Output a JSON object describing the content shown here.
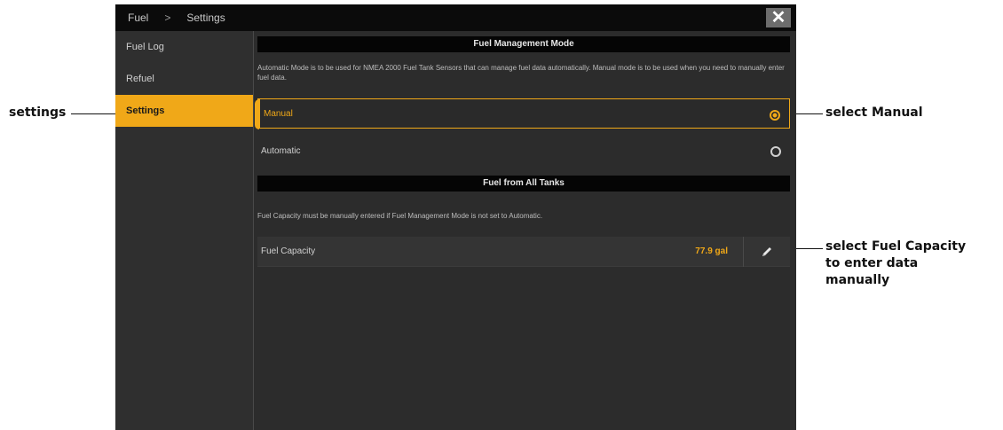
{
  "window": {
    "breadcrumb": [
      "Fuel",
      "Settings"
    ],
    "breadcrumb_sep": ">",
    "close_label": "✕"
  },
  "sidebar": {
    "items": [
      {
        "label": "Fuel Log",
        "active": false
      },
      {
        "label": "Refuel",
        "active": false
      },
      {
        "label": "Settings",
        "active": true
      }
    ]
  },
  "main": {
    "mode_header": "Fuel Management Mode",
    "mode_desc": "Automatic Mode is to be used for NMEA 2000 Fuel Tank Sensors that can manage fuel data automatically. Manual mode is to be used when you need to manually enter fuel data.",
    "options": [
      {
        "label": "Manual",
        "selected": true
      },
      {
        "label": "Automatic",
        "selected": false
      }
    ],
    "tanks_header": "Fuel from All Tanks",
    "tanks_desc": "Fuel Capacity must be manually entered if Fuel Management Mode is not set to Automatic.",
    "capacity": {
      "label": "Fuel Capacity",
      "value": "77.9 gal"
    }
  },
  "callouts": {
    "settings": "settings",
    "manual": "select Manual",
    "capacity_line1": "select Fuel Capacity",
    "capacity_line2": "to enter data",
    "capacity_line3": "manually"
  },
  "colors": {
    "accent": "#f0a818",
    "panel": "#2c2c2c",
    "bar": "#050505"
  }
}
